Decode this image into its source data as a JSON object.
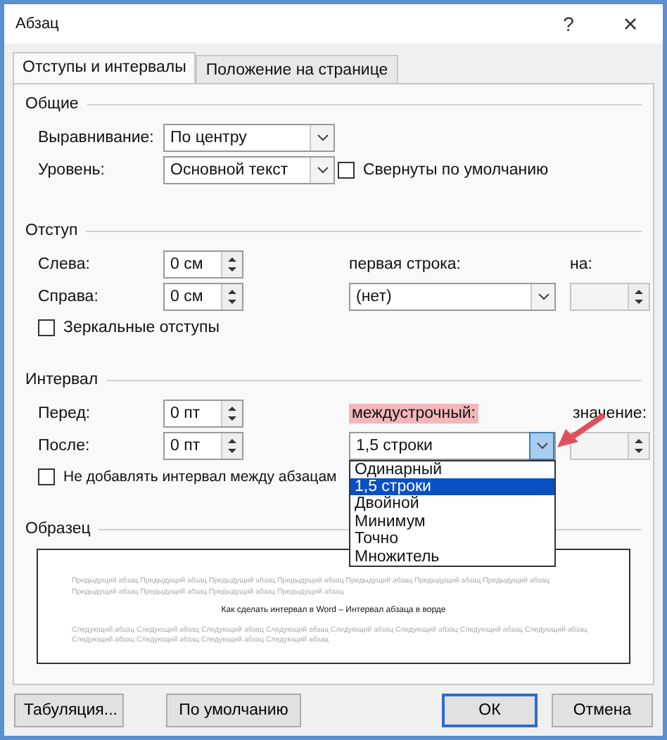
{
  "window": {
    "title": "Абзац",
    "help": "?",
    "close": "×"
  },
  "tabs": [
    {
      "label": "Отступы и интервалы",
      "selected": true
    },
    {
      "label": "Положение на странице",
      "selected": false
    }
  ],
  "general": {
    "heading": "Общие",
    "alignment": {
      "label": "Выравнивание:",
      "value": "По центру"
    },
    "level": {
      "label": "Уровень:",
      "value": "Основной текст"
    },
    "collapsed": {
      "label": "Свернуты по умолчанию",
      "checked": false
    }
  },
  "indent": {
    "heading": "Отступ",
    "left": {
      "label": "Слева:",
      "value": "0 см"
    },
    "right": {
      "label": "Справа:",
      "value": "0 см"
    },
    "first_line": {
      "label": "первая строка:",
      "value": "(нет)"
    },
    "by": {
      "label": "на:"
    },
    "mirror": {
      "label": "Зеркальные отступы",
      "checked": false
    }
  },
  "spacing": {
    "heading": "Интервал",
    "before": {
      "label": "Перед:",
      "value": "0 пт"
    },
    "after": {
      "label": "После:",
      "value": "0 пт"
    },
    "line_spacing": {
      "label": "междустрочный:",
      "highlighted": true,
      "value": "1,5 строки",
      "open": true,
      "options": [
        {
          "label": "Одинарный",
          "selected": false
        },
        {
          "label": "1,5 строки",
          "selected": true
        },
        {
          "label": "Двойной",
          "selected": false
        },
        {
          "label": "Минимум",
          "selected": false
        },
        {
          "label": "Точно",
          "selected": false
        },
        {
          "label": "Множитель",
          "selected": false
        }
      ]
    },
    "at": {
      "label": "значение:"
    },
    "no_space": {
      "label": "Не добавлять интервал между абзацам",
      "checked": false
    }
  },
  "preview": {
    "heading": "Образец",
    "previous": "Предыдущий абзац Предыдущий абзац Предыдущий абзац Предыдущий абзац Предыдущий абзац Предыдущий абзац Предыдущий абзац Предыдущий абзац Предыдущий абзац Предыдущий абзац Предыдущий абзац",
    "current": "Как сделать интервал в Word – Интервал абзаца в ворде",
    "next": "Следующий абзац Следующий абзац Следующий абзац Следующий абзац Следующий абзац Следующий абзац Следующий абзац Следующий абзац Следующий абзац Следующий абзац Следующий абзац Следующий абзац"
  },
  "buttons": [
    {
      "label": "Табуляция...",
      "default": false
    },
    {
      "label": "По умолчанию",
      "default": false
    },
    {
      "label": "ОК",
      "default": true
    },
    {
      "label": "Отмена",
      "default": false
    }
  ]
}
